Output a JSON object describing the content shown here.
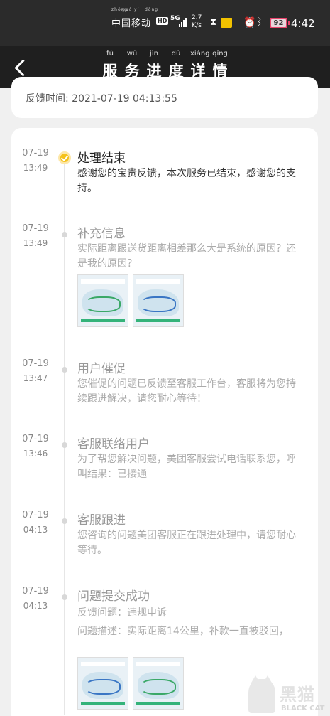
{
  "status_bar": {
    "carrier": "中国移动",
    "carrier_pinyin": [
      "zhōng",
      "guó",
      "yí",
      "dòng"
    ],
    "hd": "HD",
    "network": "5G",
    "speed_value": "2.7",
    "speed_unit": "K/s",
    "battery": "92",
    "time": "4:42",
    "icons": [
      "signal-icon",
      "hourglass-icon",
      "app-notification-icon",
      "alarm-icon",
      "bluetooth-icon",
      "battery-icon"
    ]
  },
  "header": {
    "title_chars": [
      "服",
      "务",
      "进",
      "度",
      "详",
      "情"
    ],
    "title_pinyin": [
      "fú",
      "wù",
      "jìn",
      "dù",
      "xiáng",
      "qíng"
    ],
    "back_icon": "back-arrow-icon"
  },
  "feedback": {
    "label": "反馈时间:",
    "value": "2021-07-19 04:13:55"
  },
  "timeline": [
    {
      "date": "07-19",
      "time": "13:49",
      "title": "处理结束",
      "desc": "感谢您的宝贵反馈，本次服务已结束，感谢您的支持。",
      "active": true
    },
    {
      "date": "07-19",
      "time": "13:49",
      "title": "补充信息",
      "desc": "实际距离跟送货距离相差那么大是系统的原因？还是我的原因？",
      "images": 2
    },
    {
      "date": "07-19",
      "time": "13:47",
      "title": "用户催促",
      "desc": "您催促的问题已反馈至客服工作台，客服将为您持续跟进解决，请您耐心等待！"
    },
    {
      "date": "07-19",
      "time": "13:46",
      "title": "客服联络用户",
      "desc": "为了帮您解决问题，美团客服尝试电话联系您，呼叫结果：已接通"
    },
    {
      "date": "07-19",
      "time": "04:13",
      "title": "客服跟进",
      "desc": "您咨询的问题美团客服正在跟进处理中，请您耐心等待。"
    },
    {
      "date": "07-19",
      "time": "04:13",
      "title": "问题提交成功",
      "desc": "反馈问题：违规申诉",
      "desc2": "问题描述：实际距离14公里，补款一直被驳回，",
      "images": 2
    }
  ],
  "watermark": {
    "cn": "黑猫",
    "en": "BLACK CAT"
  },
  "colors": {
    "active_dot": "#f5c21a",
    "header_bg": "#1f1f1f",
    "status_bg": "#2b2b2b",
    "battery_border": "#e8436b"
  }
}
